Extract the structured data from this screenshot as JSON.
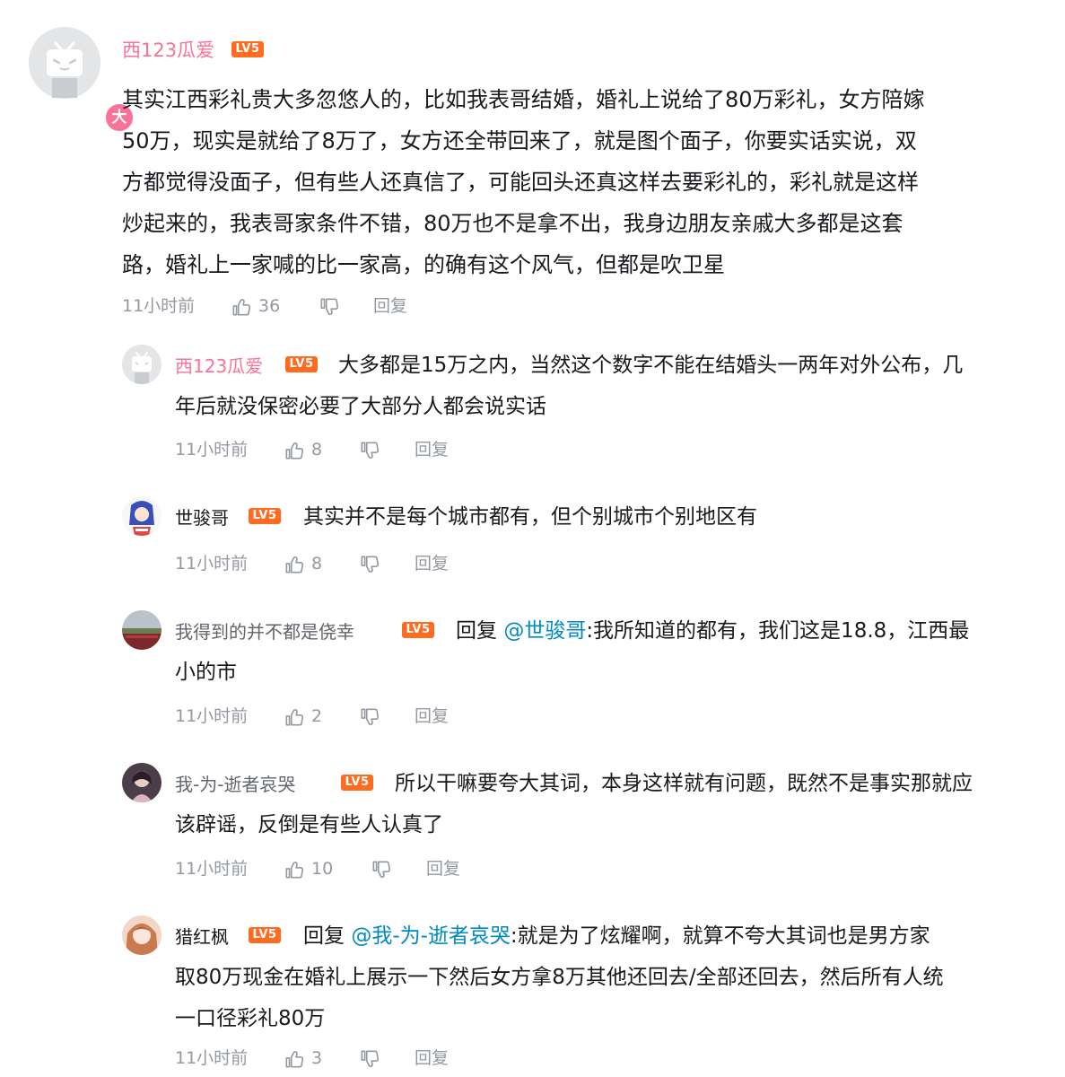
{
  "main_comment": {
    "username": "西123瓜爱",
    "level": "LV5",
    "vip_badge": "大",
    "text": "其实江西彩礼贵大多忽悠人的，比如我表哥结婚，婚礼上说给了80万彩礼，女方陪嫁\n50万，现实是就给了8万了，女方还全带回来了，就是图个面子，你要实话实说，双\n方都觉得没面子，但有些人还真信了，可能回头还真这样去要彩礼的，彩礼就是这样\n炒起来的，我表哥家条件不错，80万也不是拿不出，我身边朋友亲戚大多都是这套\n路，婚礼上一家喊的比一家高，的确有这个风气，但都是吹卫星",
    "time": "11小时前",
    "likes": "36",
    "reply_label": "回复"
  },
  "replies": [
    {
      "username": "西123瓜爱",
      "level": "LV5",
      "reply_prefix": "",
      "mention": "",
      "text_line1": "大多都是15万之内，当然这个数字不能在结婚头一两年对外公布，几",
      "text_rest": "年后就没保密必要了大部分人都会说实话",
      "time": "11小时前",
      "likes": "8",
      "reply_label": "回复"
    },
    {
      "username": "世骏哥",
      "level": "LV5",
      "reply_prefix": "",
      "mention": "",
      "text_line1": "其实并不是每个城市都有，但个别城市个别地区有",
      "text_rest": "",
      "time": "11小时前",
      "likes": "8",
      "reply_label": "回复"
    },
    {
      "username": "我得到的并不都是侥幸",
      "level": "LV5",
      "reply_prefix": "回复",
      "mention": "@世骏哥",
      "text_line1": ":我所知道的都有，我们这是18.8，江西最",
      "text_rest": "小的市",
      "time": "11小时前",
      "likes": "2",
      "reply_label": "回复"
    },
    {
      "username": "我-为-逝者哀哭",
      "level": "LV5",
      "reply_prefix": "",
      "mention": "",
      "text_line1": "所以干嘛要夸大其词，本身这样就有问题，既然不是事实那就应",
      "text_rest": "该辟谣，反倒是有些人认真了",
      "time": "11小时前",
      "likes": "10",
      "reply_label": "回复"
    },
    {
      "username": "猎红枫",
      "level": "LV5",
      "reply_prefix": "回复",
      "mention": "@我-为-逝者哀哭",
      "text_line1": ":就是为了炫耀啊，就算不夸大其词也是男方家",
      "text_rest": "取80万现金在婚礼上展示一下然后女方拿8万其他还回去/全部还回去，然后所有人统\n一口径彩礼80万",
      "time": "11小时前",
      "likes": "3",
      "reply_label": "回复"
    }
  ],
  "colors": {
    "vip_name": "#fb7299",
    "plain_name": "#61666d",
    "level_badge": "#ff6b21",
    "mention": "#008ac5",
    "meta": "#9499a0",
    "text": "#18191c"
  }
}
